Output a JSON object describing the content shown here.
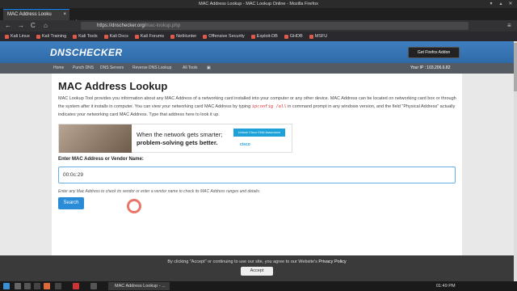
{
  "window": {
    "title": "MAC Address Lookup - MAC Lookup Online - Mozilla Firefox"
  },
  "tab": {
    "label": "MAC Address Looku",
    "close": "×",
    "new": "+"
  },
  "nav": {
    "back": "←",
    "forward": "→",
    "reload": "C",
    "home": "⌂",
    "url_domain": "https://dnschecker.org/",
    "url_path": "mac-lookup.php",
    "menu": "≡"
  },
  "bookmarks": [
    "Kali Linux",
    "Kali Training",
    "Kali Tools",
    "Kali Docs",
    "Kali Forums",
    "NetHunter",
    "Offensive Security",
    "Exploit-DB",
    "GHDB",
    "MSFU"
  ],
  "site": {
    "logo": "DNSCHECKER",
    "addon_button": "Get Firefox Addon",
    "menu": [
      "Home",
      "Punch DNS",
      "DNS Servers",
      "Reverse DNS Lookup",
      "All Tools"
    ],
    "ip_label": "Your IP : 103.206.6.82"
  },
  "page": {
    "heading": "MAC Address Lookup",
    "description_a": "MAC Lookup Tool provides you information about any MAC Address of a networking card installed into your computer or any other device. MAC Address can be located on networking card box or through the system after it installs in computer. You can view your networking card MAC Address by typing ",
    "command": "ipconfig /all",
    "description_b": " in command prompt in any windows version, and the field \"Physical Address\" actually indicates your networking card MAC Address. Type that address here to look it up.",
    "ad_line1": "When the network gets smarter;",
    "ad_line2": "problem-solving gets better.",
    "ad_button": "Unlock Cisco DNA Assurance",
    "ad_brand": "cisco",
    "input_label": "Enter MAC Address or Vendor Name:",
    "input_value": "00:0c:29",
    "hint": "Enter any Mac Address to check its vendor or enter a vendor name to check its MAC Address ranges and details.",
    "search_button": "Search"
  },
  "cookie": {
    "text": "By clicking \"Accept\" or continuing to use our site, you agree to our Website's ",
    "link": "Privacy Policy",
    "accept": "Accept"
  },
  "taskbar": {
    "window": "MAC Address Lookup - ...",
    "time": "01:49 PM"
  }
}
